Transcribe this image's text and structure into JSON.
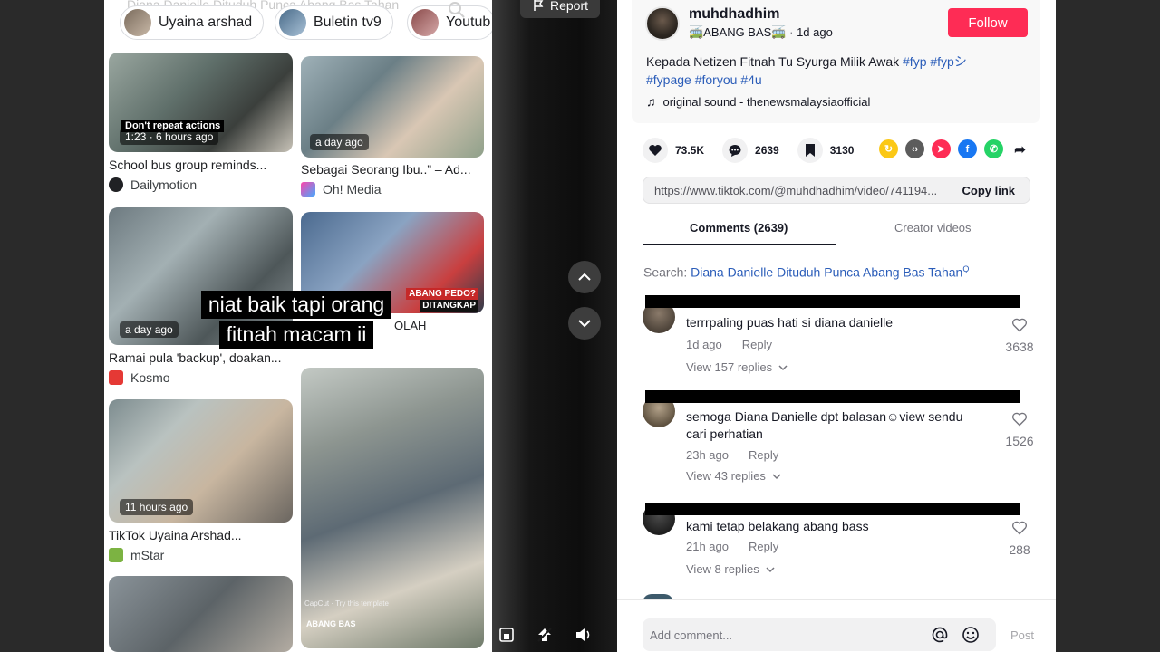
{
  "video": {
    "ghost_title": "Diana Danielle Dituduh Punca Abang Bas Tahan",
    "chips": [
      "Uyaina arshad",
      "Buletin tv9",
      "Youtub"
    ],
    "results": [
      {
        "timestamp": "1:23 · 6 hours ago",
        "caption": "School bus group reminds...",
        "source": "Dailymotion"
      },
      {
        "timestamp": "a day ago",
        "caption": "Sebagai Seorang Ibu..” – Ad...",
        "source": "Oh! Media"
      },
      {
        "timestamp": "a day ago",
        "caption": "Ramai pula 'backup', doakan...",
        "source": "Kosmo"
      },
      {
        "timestamp": "11 hours ago",
        "caption": "TikTok Uyaina Arshad...",
        "source": "mStar"
      }
    ],
    "thumb_texts": {
      "dont_repeat": "Don't repeat actions",
      "abang_pedo": "ABANG PEDO?",
      "ditangkap": "DITANGKAP",
      "olah": "OLAH",
      "capcut": "CapCut · Try this template",
      "abang_bas": "ABANG BAS"
    },
    "overlay_lines": [
      "niat baik tapi orang",
      "fitnah macam ii"
    ],
    "report_label": "Report"
  },
  "post": {
    "username": "muhdhadhim",
    "nickname": "🚎ABANG BAS🚎",
    "time": "1d ago",
    "follow_label": "Follow",
    "description_text": "Kepada Netizen Fitnah Tu Syurga Milik Awak",
    "hashtags": [
      "#fyp",
      "#fypシ",
      "#fypage",
      "#foryou",
      "#4u"
    ],
    "sound": "original sound - thenewsmalaysiaofficial",
    "likes": "73.5K",
    "comments": "2639",
    "saves": "3130",
    "link": "https://www.tiktok.com/@muhdhadhim/video/741194...",
    "copy_label": "Copy link"
  },
  "tabs": {
    "comments": "Comments (2639)",
    "creator": "Creator videos"
  },
  "search": {
    "label": "Search:",
    "query": "Diana Danielle Dituduh Punca Abang Bas Tahan"
  },
  "comments": [
    {
      "text": "terrrpaling puas hati si diana danielle",
      "time": "1d ago",
      "reply": "Reply",
      "replies": "View 157 replies",
      "likes": "3638"
    },
    {
      "text": "semoga Diana Danielle dpt balasan☺view sendu cari perhatian",
      "time": "23h ago",
      "reply": "Reply",
      "replies": "View 43 replies",
      "likes": "1526"
    },
    {
      "text": "kami tetap belakang abang bass",
      "time": "21h ago",
      "reply": "Reply",
      "replies": "View 8 replies",
      "likes": "288"
    }
  ],
  "composer": {
    "placeholder": "Add comment...",
    "post_label": "Post"
  },
  "colors": {
    "accent": "#fe2c55",
    "link": "#2b5db9"
  }
}
